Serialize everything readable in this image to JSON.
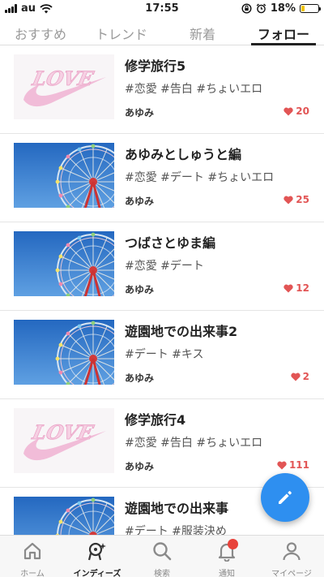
{
  "status_bar": {
    "carrier": "au",
    "time": "17:55",
    "battery": "18%",
    "battery_level": 0.18,
    "icons": [
      "signal-icon",
      "wifi-icon",
      "rotation-lock-icon",
      "alarm-icon",
      "battery-icon"
    ]
  },
  "tabs": [
    {
      "label": "おすすめ",
      "active": false
    },
    {
      "label": "トレンド",
      "active": false
    },
    {
      "label": "新着",
      "active": false
    },
    {
      "label": "フォロー",
      "active": true
    }
  ],
  "stories": [
    {
      "title": "修学旅行5",
      "tags": "#恋愛 #告白 #ちょいエロ",
      "author": "あゆみ",
      "likes": "20",
      "thumbnail": "love-logo",
      "thumb_text": "LOVE"
    },
    {
      "title": "あゆみとしゅうと編",
      "tags": "#恋愛 #デート #ちょいエロ",
      "author": "あゆみ",
      "likes": "25",
      "thumbnail": "ferris-wheel"
    },
    {
      "title": "つばさとゆま編",
      "tags": "#恋愛 #デート",
      "author": "あゆみ",
      "likes": "12",
      "thumbnail": "ferris-wheel"
    },
    {
      "title": "遊園地での出来事2",
      "tags": "#デート #キス",
      "author": "あゆみ",
      "likes": "2",
      "thumbnail": "ferris-wheel"
    },
    {
      "title": "修学旅行4",
      "tags": "#恋愛 #告白 #ちょいエロ",
      "author": "あゆみ",
      "likes": "111",
      "thumbnail": "love-logo",
      "thumb_text": "LOVE"
    },
    {
      "title": "遊園地での出来事",
      "tags": "#デート #服装決め",
      "author": "",
      "likes": "",
      "thumbnail": "ferris-wheel"
    }
  ],
  "fab": {
    "icon": "pencil-icon"
  },
  "bottom_nav": [
    {
      "label": "ホーム",
      "icon": "home-icon",
      "active": false
    },
    {
      "label": "インディーズ",
      "icon": "indies-icon",
      "active": true
    },
    {
      "label": "検索",
      "icon": "search-icon",
      "active": false
    },
    {
      "label": "通知",
      "icon": "bell-icon",
      "active": false,
      "badge": true
    },
    {
      "label": "マイページ",
      "icon": "person-icon",
      "active": false
    }
  ],
  "colors": {
    "accent": "#2e8ff0",
    "like": "#e25555",
    "badge": "#e8433b",
    "battery": "#f2c200"
  }
}
